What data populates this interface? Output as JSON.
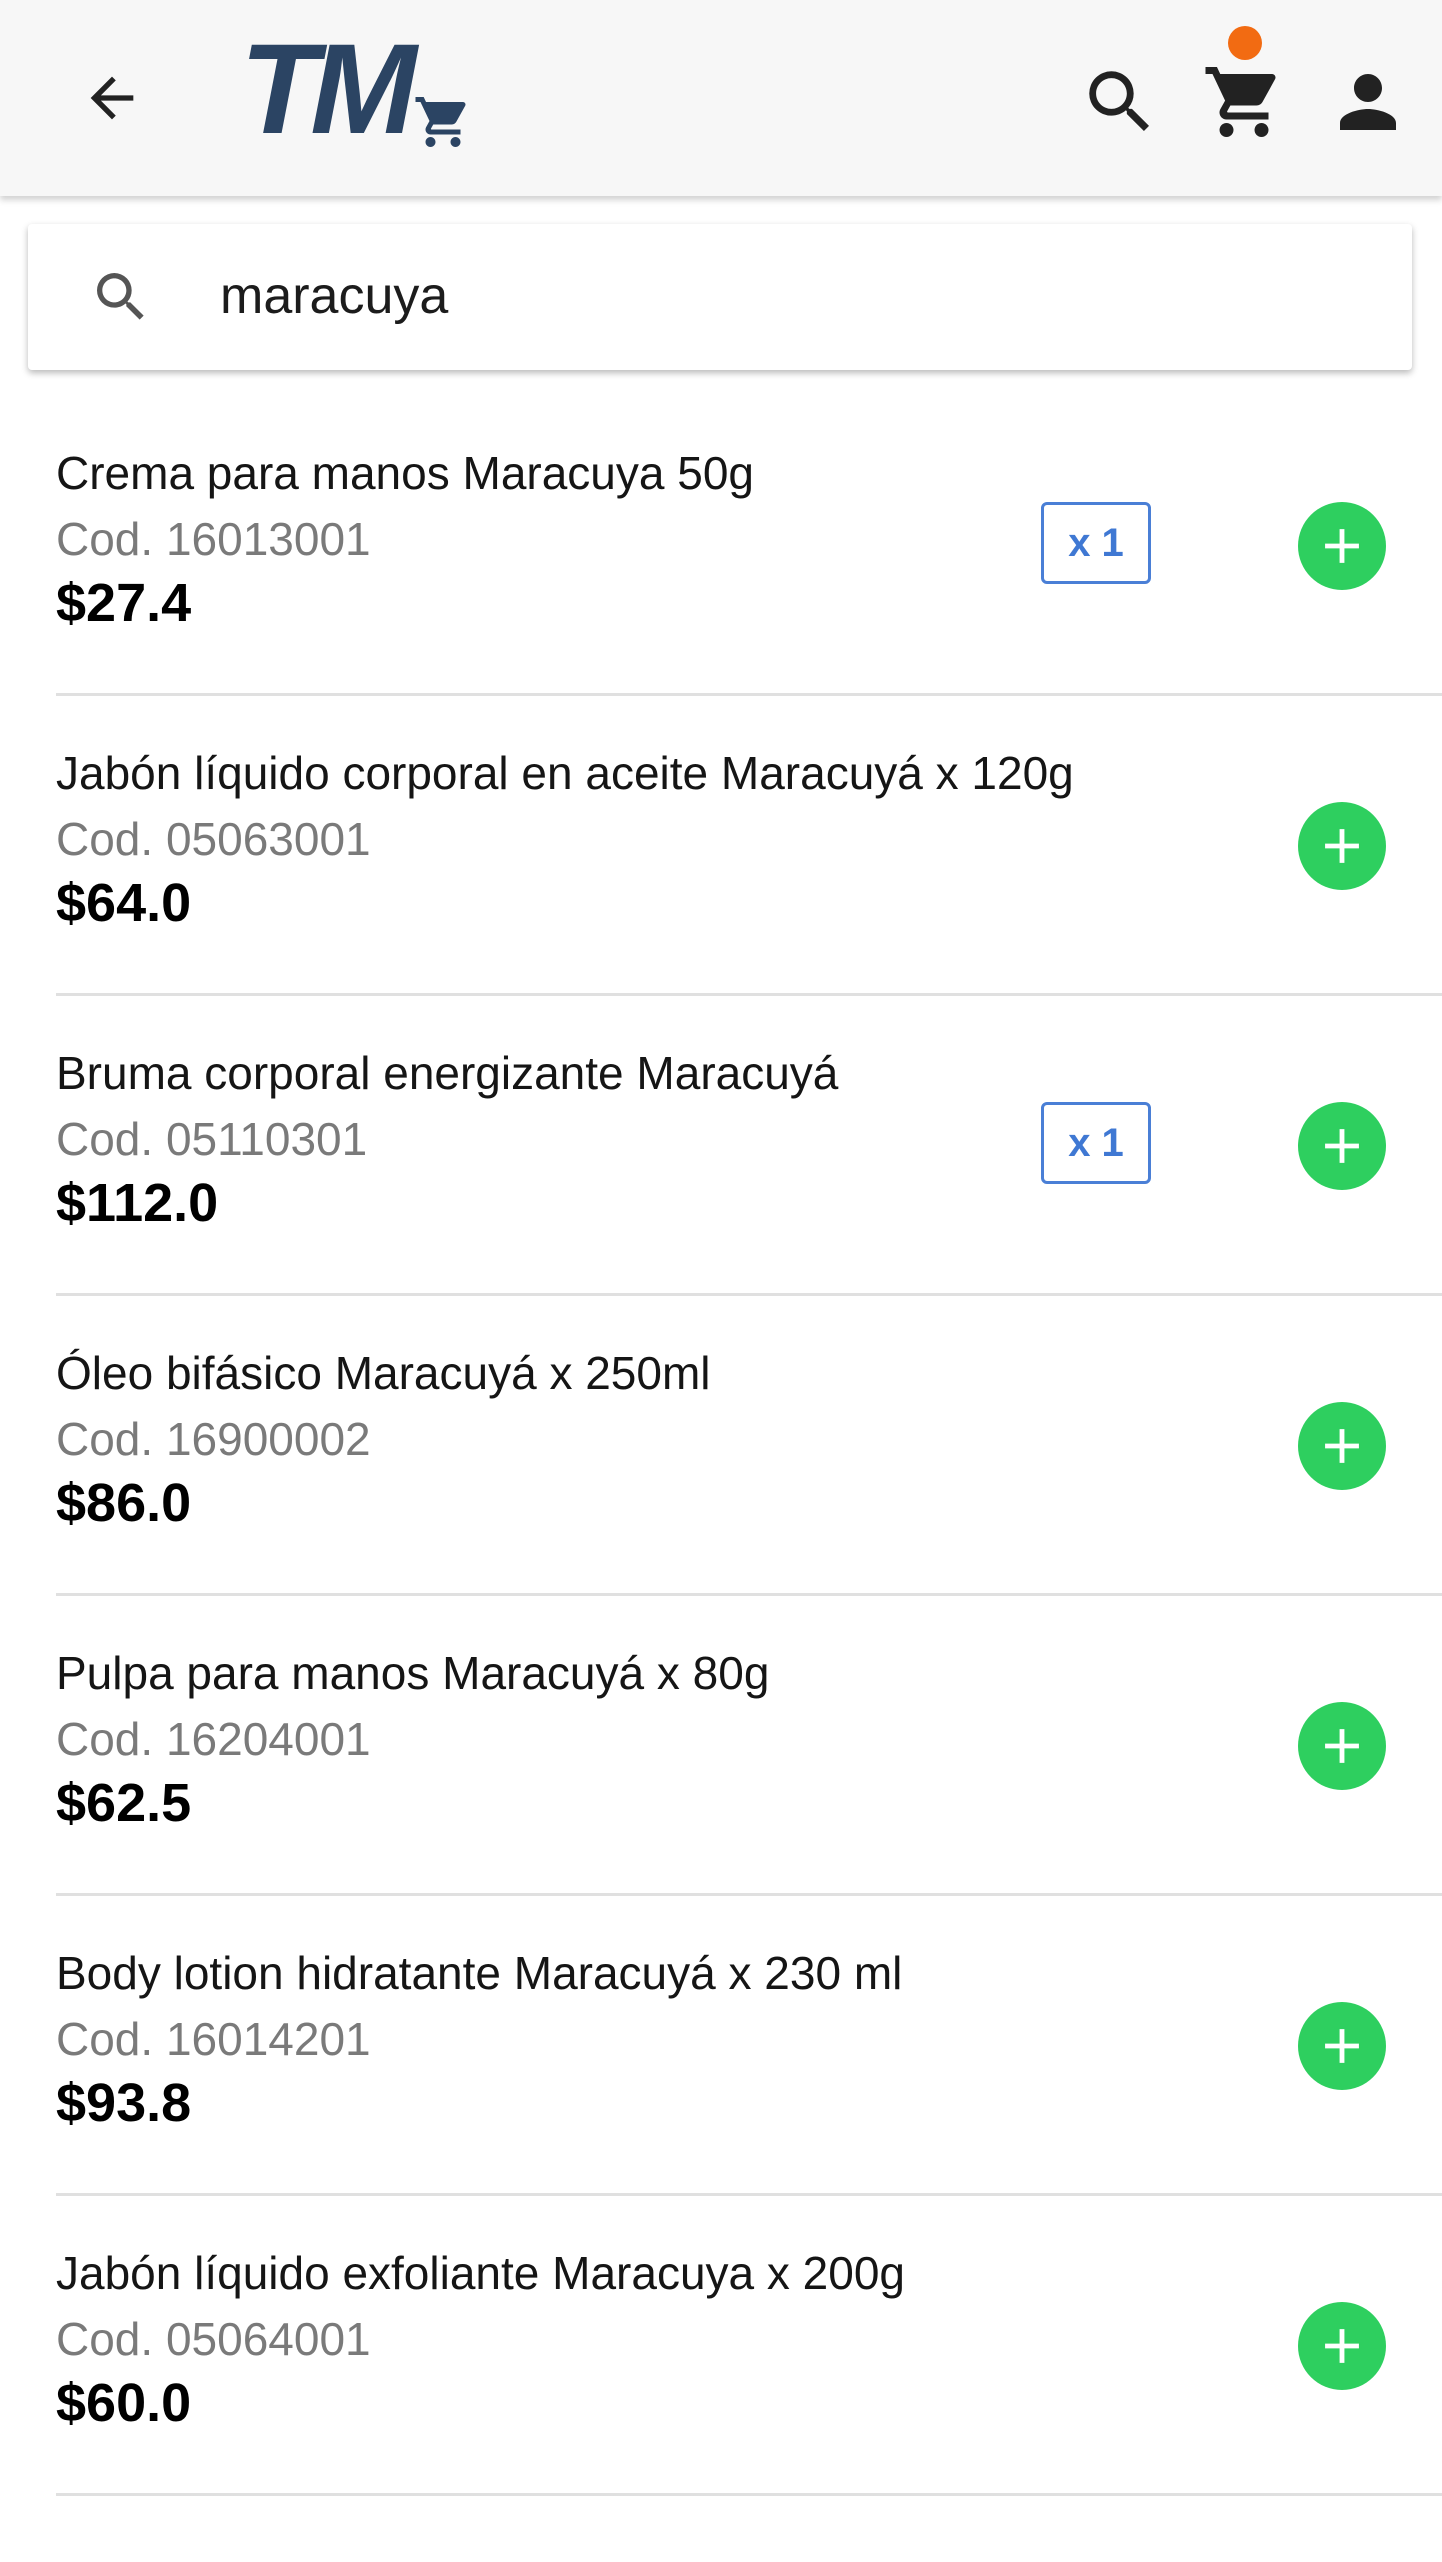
{
  "app": {
    "logo_text": "TM"
  },
  "header": {
    "back_icon": "arrow-back-icon",
    "search_icon": "search-icon",
    "cart_icon": "shopping-cart-icon",
    "user_icon": "account-icon",
    "cart_badge_color": "#f26b12",
    "bar_color": "#f7f7f7"
  },
  "search": {
    "value": "maracuya",
    "icon": "search-icon"
  },
  "colors": {
    "add_button": "#2ecf5f",
    "qty_badge": "#3f78d3",
    "logo": "#2b4463"
  },
  "products": [
    {
      "name": "Crema para manos Maracuya 50g",
      "code": "Cod. 16013001",
      "price": "$27.4",
      "qty": "x 1"
    },
    {
      "name": "Jabón líquido corporal en aceite Maracuyá x 120g",
      "code": "Cod. 05063001",
      "price": "$64.0",
      "qty": ""
    },
    {
      "name": "Bruma corporal energizante Maracuyá",
      "code": "Cod. 05110301",
      "price": "$112.0",
      "qty": "x 1"
    },
    {
      "name": "Óleo bifásico Maracuyá x 250ml",
      "code": "Cod. 16900002",
      "price": "$86.0",
      "qty": ""
    },
    {
      "name": "Pulpa para manos Maracuyá x 80g",
      "code": "Cod. 16204001",
      "price": "$62.5",
      "qty": ""
    },
    {
      "name": "Body lotion hidratante Maracuyá x 230 ml",
      "code": "Cod. 16014201",
      "price": "$93.8",
      "qty": ""
    },
    {
      "name": "Jabón líquido exfoliante Maracuya x 200g",
      "code": "Cod. 05064001",
      "price": "$60.0",
      "qty": ""
    }
  ]
}
